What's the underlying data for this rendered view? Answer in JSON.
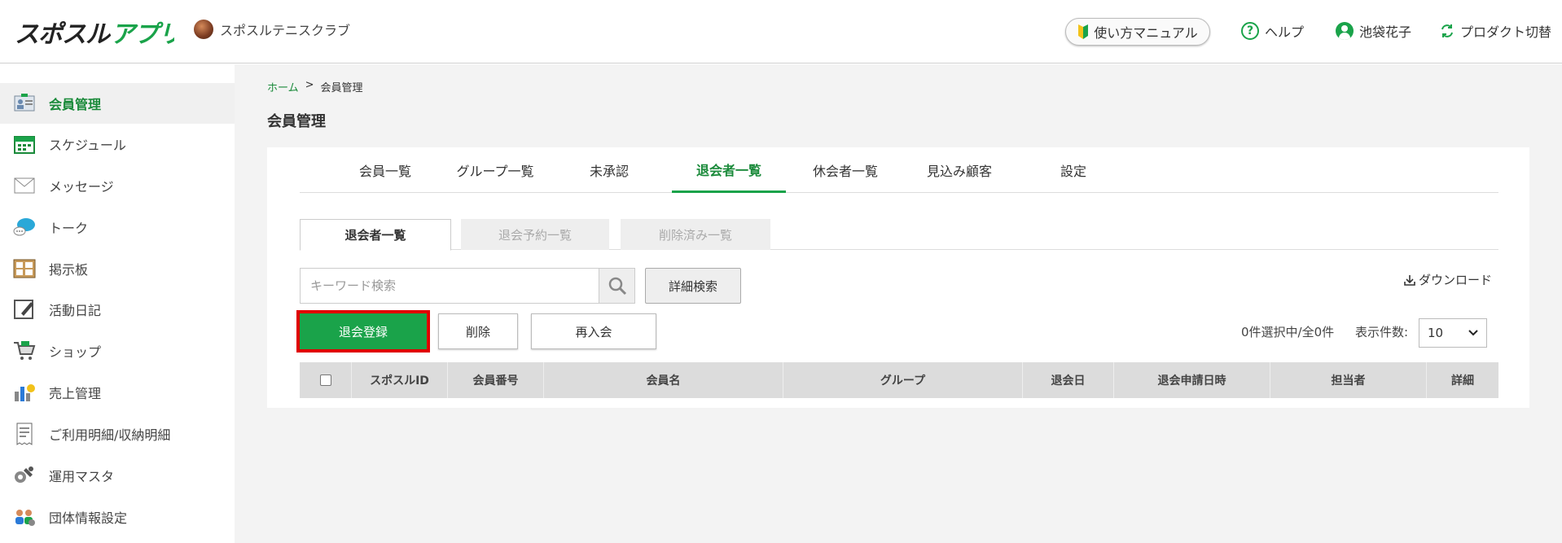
{
  "header": {
    "logo_text": "スポスルアプリ",
    "club_name": "スポスルテニスクラブ",
    "manual_label": "使い方マニュアル",
    "help_label": "ヘルプ",
    "user_name": "池袋花子",
    "switch_label": "プロダクト切替"
  },
  "sidebar": {
    "items": [
      {
        "label": "会員管理",
        "icon": "member-icon"
      },
      {
        "label": "スケジュール",
        "icon": "calendar-icon"
      },
      {
        "label": "メッセージ",
        "icon": "mail-icon"
      },
      {
        "label": "トーク",
        "icon": "chat-icon"
      },
      {
        "label": "掲示板",
        "icon": "board-icon"
      },
      {
        "label": "活動日記",
        "icon": "diary-icon"
      },
      {
        "label": "ショップ",
        "icon": "cart-icon"
      },
      {
        "label": "売上管理",
        "icon": "sales-icon"
      },
      {
        "label": "ご利用明細/収納明細",
        "icon": "receipt-icon"
      },
      {
        "label": "運用マスタ",
        "icon": "wrench-icon"
      },
      {
        "label": "団体情報設定",
        "icon": "group-icon"
      }
    ]
  },
  "breadcrumb": {
    "home": "ホーム",
    "sep": ">",
    "current": "会員管理"
  },
  "page_title": "会員管理",
  "tabs": [
    "会員一覧",
    "グループ一覧",
    "未承認",
    "退会者一覧",
    "休会者一覧",
    "見込み顧客",
    "設定"
  ],
  "subtabs": [
    "退会者一覧",
    "退会予約一覧",
    "削除済み一覧"
  ],
  "search": {
    "placeholder": "キーワード検索",
    "advanced_label": "詳細検索"
  },
  "download_label": "ダウンロード",
  "actions": {
    "register": "退会登録",
    "delete": "削除",
    "rejoin": "再入会"
  },
  "count_text": "0件選択中/全0件",
  "perpage": {
    "label": "表示件数:",
    "value": "10"
  },
  "table": {
    "headers": [
      "スポスルID",
      "会員番号",
      "会員名",
      "グループ",
      "退会日",
      "退会申請日時",
      "担当者",
      "詳細"
    ]
  },
  "colors": {
    "accent": "#1aa34a",
    "highlight": "#e00000"
  }
}
